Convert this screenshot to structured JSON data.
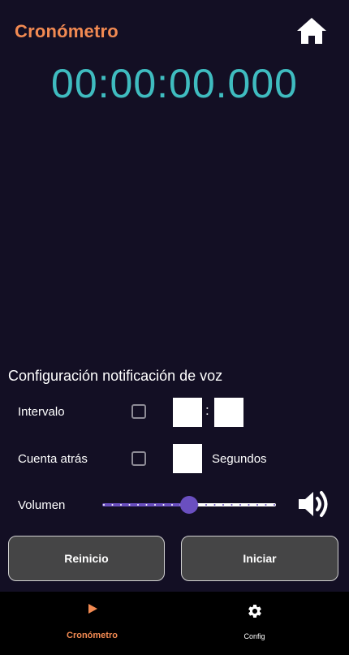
{
  "header": {
    "title": "Cronómetro",
    "home_icon": "home-icon"
  },
  "timer": {
    "display": "00:00:00.000"
  },
  "voice_config": {
    "section_title": "Configuración notificación de voz",
    "interval": {
      "label": "Intervalo",
      "checked": false,
      "minutes_value": "",
      "separator": ":",
      "seconds_value": ""
    },
    "countdown": {
      "label": "Cuenta atrás",
      "checked": false,
      "value": "",
      "unit_label": "Segundos"
    },
    "volume": {
      "label": "Volumen",
      "level": 0.5,
      "icon": "volume-icon"
    }
  },
  "actions": {
    "reset_label": "Reinicio",
    "start_label": "Iniciar"
  },
  "bottom_nav": {
    "items": [
      {
        "label": "Cronómetro",
        "icon": "play-icon",
        "active": true
      },
      {
        "label": "Config",
        "icon": "gear-icon",
        "active": false
      }
    ]
  },
  "colors": {
    "background": "#130f24",
    "title": "#f28a52",
    "timer": "#3fbcc0",
    "slider_accent": "#6a4fc0",
    "button_bg": "#454546",
    "nav_bg": "#000000",
    "nav_active": "#f28a52"
  }
}
